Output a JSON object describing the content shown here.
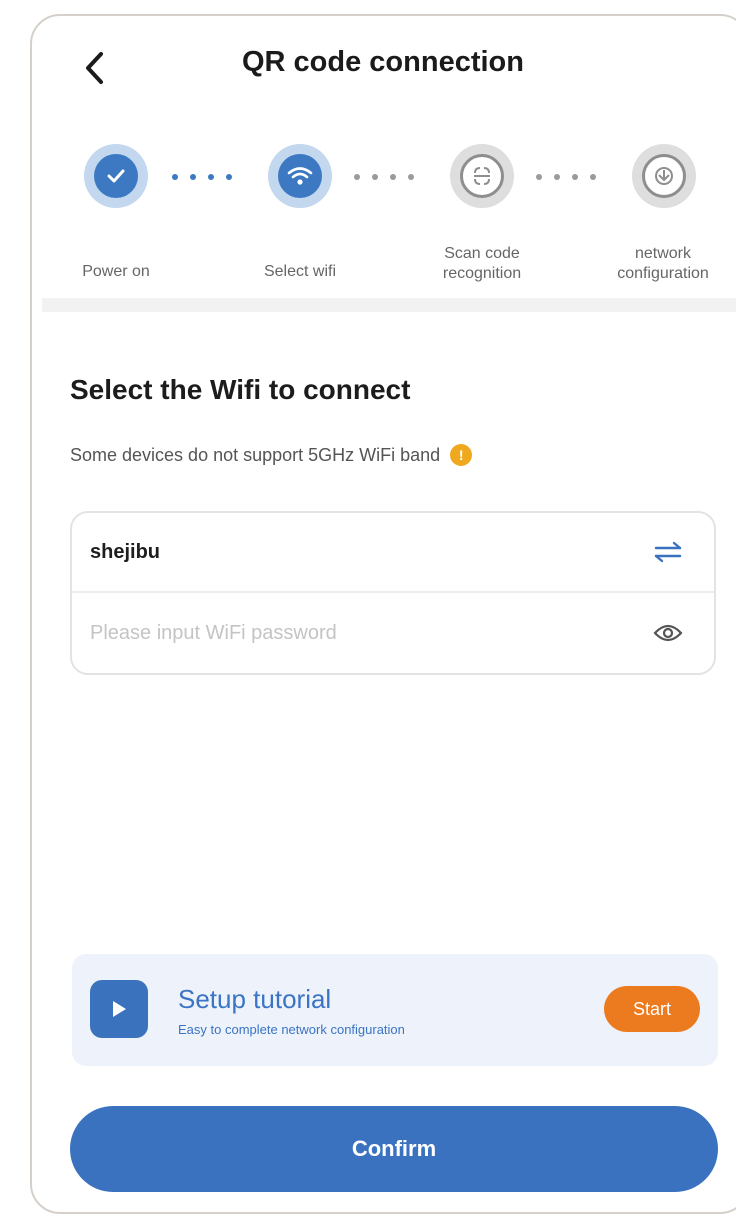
{
  "header": {
    "title": "QR code connection",
    "back_icon": "chevron-left-icon"
  },
  "stepper": {
    "steps": [
      {
        "label_line1": "Power on",
        "label_line2": "",
        "state": "done",
        "icon": "check-icon"
      },
      {
        "label_line1": "Select wifi",
        "label_line2": "",
        "state": "current",
        "icon": "wifi-icon"
      },
      {
        "label_line1": "Scan code",
        "label_line2": "recognition",
        "state": "todo",
        "icon": "scan-icon"
      },
      {
        "label_line1": "network",
        "label_line2": "configuration",
        "state": "todo",
        "icon": "network-icon"
      }
    ]
  },
  "main": {
    "section_title": "Select the Wifi to connect",
    "note": "Some devices do not support 5GHz WiFi band",
    "ssid": "shejibu",
    "password_placeholder": "Please input WiFi password",
    "password_value": ""
  },
  "tutorial": {
    "title": "Setup tutorial",
    "subtitle": "Easy to complete network configuration",
    "start_label": "Start"
  },
  "footer": {
    "confirm_label": "Confirm"
  },
  "colors": {
    "accent": "#3b72bf",
    "orange": "#ec7a1e",
    "warning": "#f0a91e"
  }
}
